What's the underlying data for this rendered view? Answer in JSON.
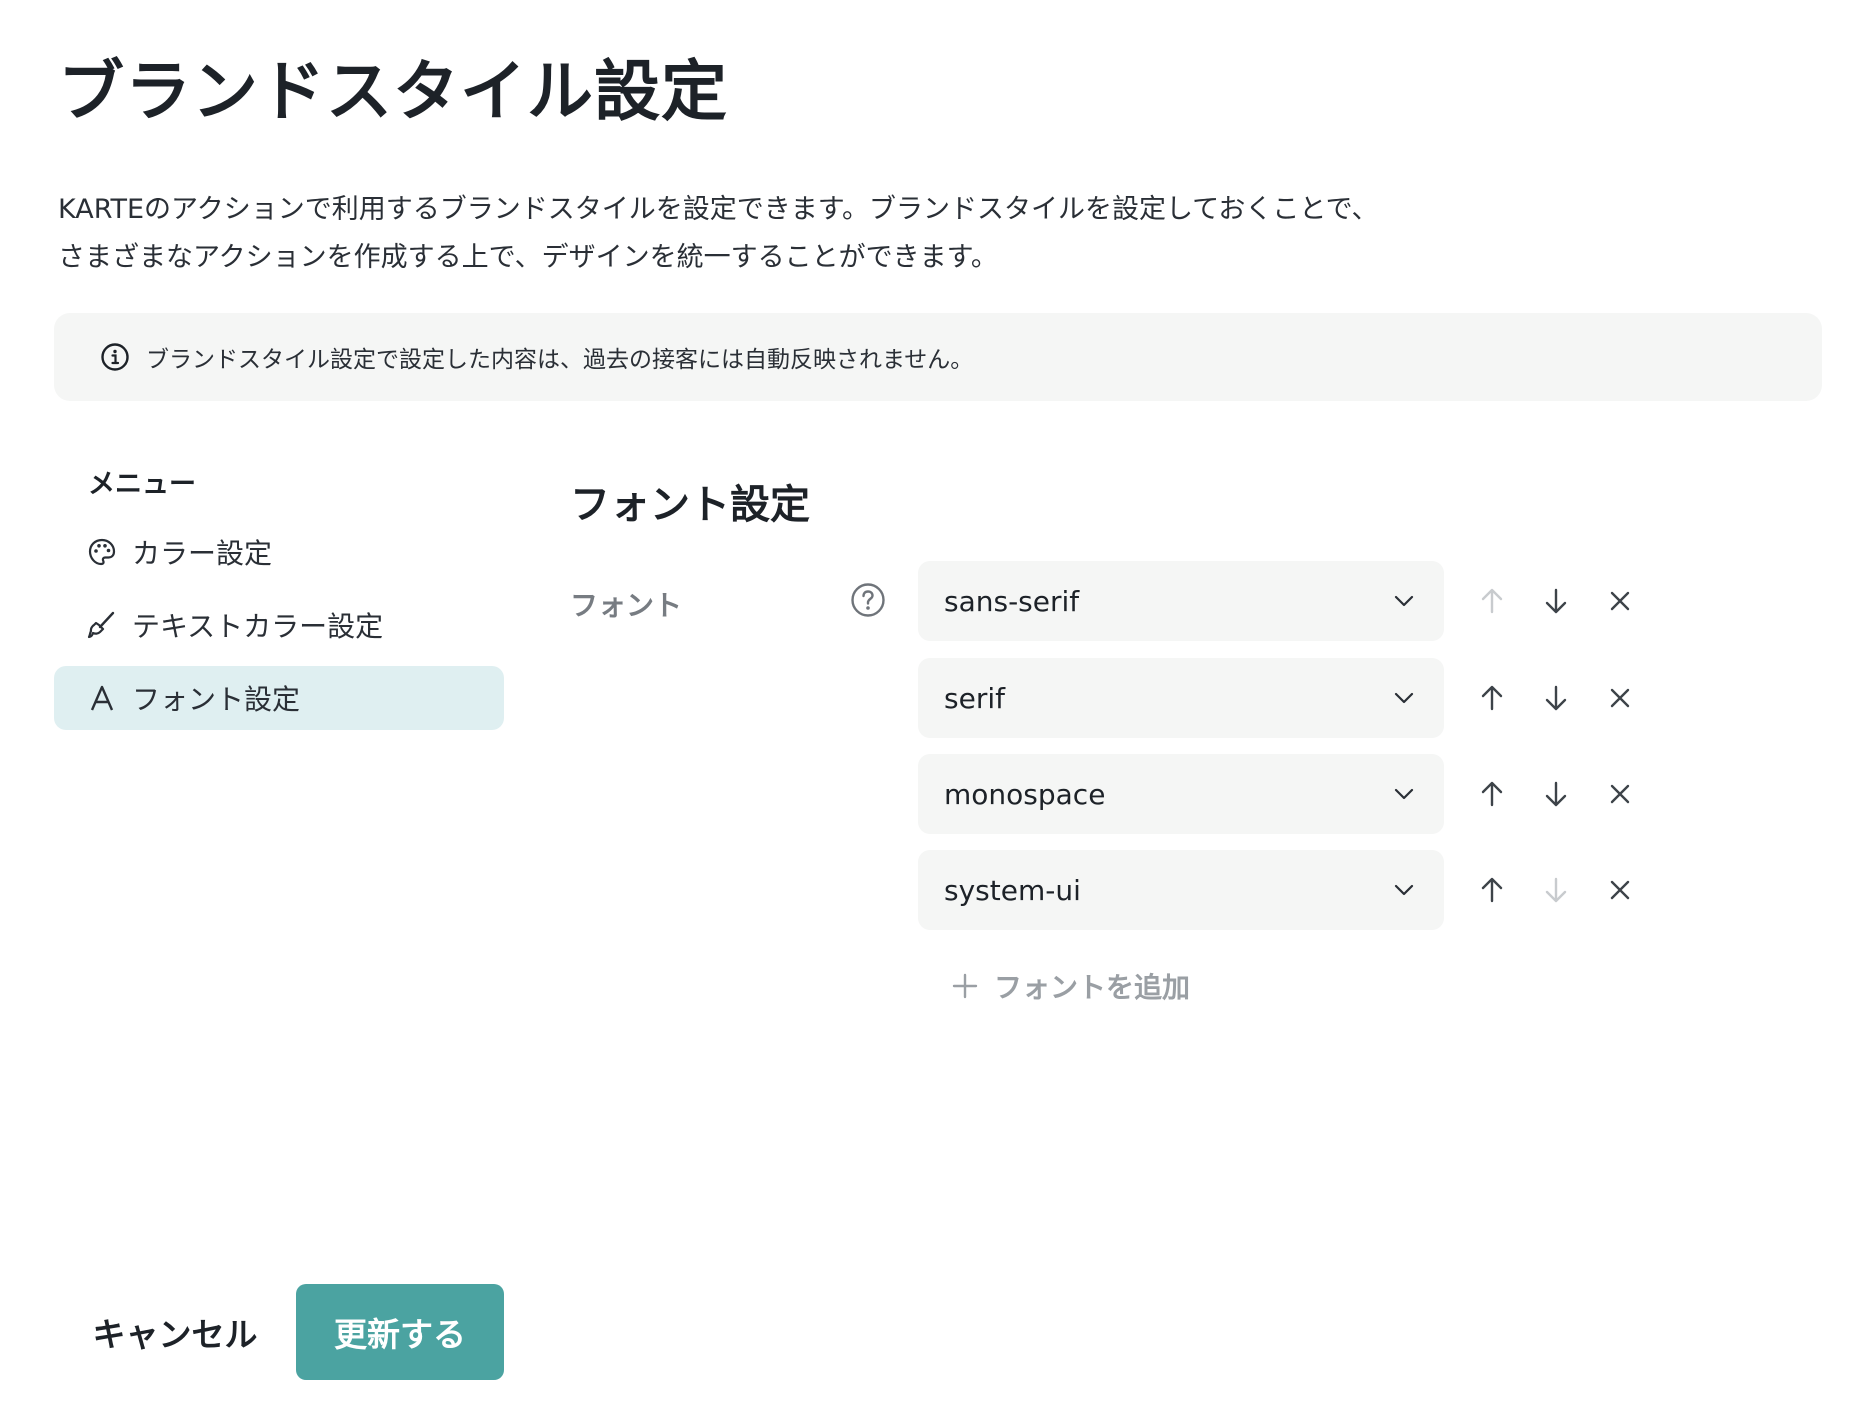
{
  "page": {
    "title": "ブランドスタイル設定",
    "description_lines": [
      "KARTEのアクションで利用するブランドスタイルを設定できます。ブランドスタイルを設定しておくことで、",
      "さまざまなアクションを作成する上で、デザインを統一することができます。"
    ],
    "notice": {
      "icon": "info-icon",
      "text": "ブランドスタイル設定で設定した内容は、過去の接客には自動反映されません。"
    }
  },
  "menu": {
    "heading": "メニュー",
    "items": [
      {
        "label": "カラー設定",
        "icon": "palette-icon",
        "active": false
      },
      {
        "label": "テキストカラー設定",
        "icon": "brush-icon",
        "active": false
      },
      {
        "label": "フォント設定",
        "icon": "font-a-icon",
        "active": true
      }
    ]
  },
  "font_settings": {
    "section_title": "フォント設定",
    "field_label": "フォント",
    "help_icon": "question-circle-icon",
    "fonts": [
      {
        "value": "sans-serif",
        "up_enabled": false,
        "down_enabled": true
      },
      {
        "value": "serif",
        "up_enabled": true,
        "down_enabled": true
      },
      {
        "value": "monospace",
        "up_enabled": true,
        "down_enabled": true
      },
      {
        "value": "system-ui",
        "up_enabled": true,
        "down_enabled": false
      }
    ],
    "add_label": "フォントを追加"
  },
  "footer": {
    "cancel_label": "キャンセル",
    "submit_label": "更新する"
  },
  "colors": {
    "accent": "#4ba3a1",
    "active_menu_bg": "#dfeff1",
    "field_bg": "#f5f6f5",
    "icon_enabled": "#3d4349",
    "icon_disabled": "#c8cbce"
  }
}
